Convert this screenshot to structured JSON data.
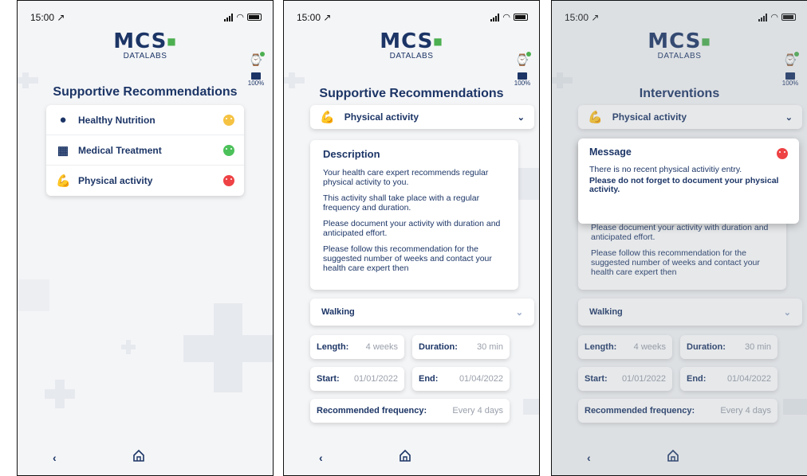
{
  "status": {
    "time": "15:00 ↗",
    "battery": "100%"
  },
  "logo": {
    "mcs": "MCS",
    "datalabs": "DATALABS"
  },
  "screen1": {
    "title": "Supportive Recommendations",
    "items": [
      {
        "label": "Healthy Nutrition",
        "icon": "apple-icon",
        "status": "yellow"
      },
      {
        "label": "Medical Treatment",
        "icon": "pill-blister-icon",
        "status": "green"
      },
      {
        "label": "Physical activity",
        "icon": "flexed-arm-icon",
        "status": "red"
      }
    ]
  },
  "screen2": {
    "title": "Supportive Recommendations",
    "dropdown": "Physical activity",
    "description": {
      "heading": "Description",
      "paragraphs": [
        "Your health care expert recommends regular physical activity to you.",
        "This activity shall take place with a regular frequency and duration.",
        "Please document your activity with duration and anticipated effort.",
        "Please follow this recommendation for the suggested number of weeks and contact your health care expert then"
      ]
    },
    "activity": "Walking",
    "length_label": "Length:",
    "length_value": "4 weeks",
    "duration_label": "Duration:",
    "duration_value": "30 min",
    "start_label": "Start:",
    "start_value": "01/01/2022",
    "end_label": "End:",
    "end_value": "01/04/2022",
    "freq_label": "Recommended frequency:",
    "freq_value": "Every 4 days"
  },
  "screen3": {
    "title": "Interventions",
    "dropdown": "Physical activity",
    "message": {
      "heading": "Message",
      "text": "There is no recent physical activitiy entry.",
      "bold_text": "Please do not forget to document your physical activity."
    },
    "partial_paragraphs": [
      "Please document your activity with duration and anticipated effort.",
      "Please follow this recommendation for the suggested number of weeks and contact your health care expert then"
    ],
    "activity": "Walking",
    "length_label": "Length:",
    "length_value": "4 weeks",
    "duration_label": "Duration:",
    "duration_value": "30 min",
    "start_label": "Start:",
    "start_value": "01/01/2022",
    "end_label": "End:",
    "end_value": "01/04/2022",
    "freq_label": "Recommended frequency:",
    "freq_value": "Every 4 days"
  },
  "nav": {
    "back": "‹"
  },
  "colors": {
    "brand": "#1c3566",
    "yellow": "#f5c242",
    "green": "#4cc15a",
    "red": "#ee4245",
    "accent_dot": "#4caf50"
  }
}
